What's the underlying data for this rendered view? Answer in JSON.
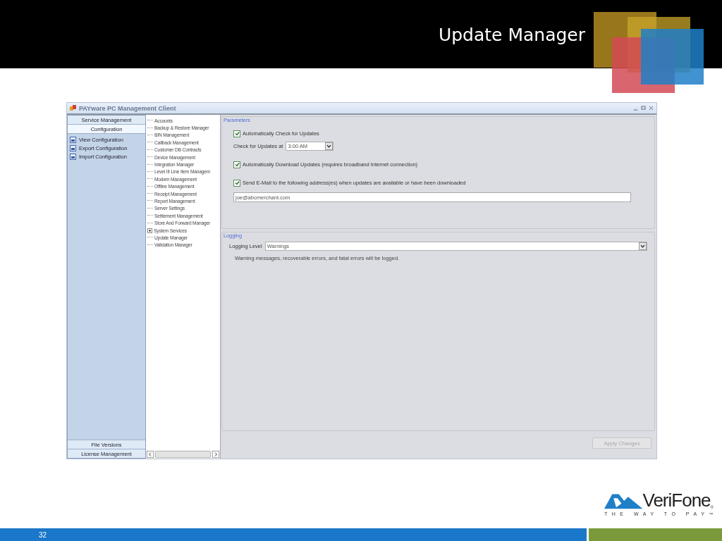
{
  "slide": {
    "title": "Update Manager",
    "page_number": "32"
  },
  "window": {
    "title": "PAYware PC Management Client"
  },
  "nav": {
    "top_buttons": [
      {
        "label": "Service Management",
        "selected": false
      },
      {
        "label": "Configuration",
        "selected": true
      }
    ],
    "items": [
      {
        "label": "View Configuration"
      },
      {
        "label": "Export Configuration"
      },
      {
        "label": "Import Configuration"
      }
    ],
    "bottom_buttons": [
      {
        "label": "File Versions"
      },
      {
        "label": "License Management"
      }
    ]
  },
  "tree": {
    "items": [
      {
        "label": "Accounts",
        "kind": "leaf"
      },
      {
        "label": "Backup & Restore Manager",
        "kind": "leaf"
      },
      {
        "label": "BIN Management",
        "kind": "leaf"
      },
      {
        "label": "Callback Management",
        "kind": "leaf"
      },
      {
        "label": "Customer DB Contracts",
        "kind": "leaf"
      },
      {
        "label": "Device Management",
        "kind": "leaf"
      },
      {
        "label": "Integration Manager",
        "kind": "leaf"
      },
      {
        "label": "Level III Line Item Managem",
        "kind": "leaf"
      },
      {
        "label": "Modem Management",
        "kind": "leaf"
      },
      {
        "label": "Offline Management",
        "kind": "leaf"
      },
      {
        "label": "Receipt Management",
        "kind": "leaf"
      },
      {
        "label": "Report Management",
        "kind": "leaf"
      },
      {
        "label": "Server Settings",
        "kind": "leaf"
      },
      {
        "label": "Settlement Management",
        "kind": "leaf"
      },
      {
        "label": "Store And Forward Manager",
        "kind": "leaf"
      },
      {
        "label": "System Services",
        "kind": "folder",
        "expanded": false
      },
      {
        "label": "Update Manager",
        "kind": "leaf"
      },
      {
        "label": "Validation Manager",
        "kind": "leaf"
      }
    ]
  },
  "parameters": {
    "title": "Parameters",
    "auto_check": {
      "label": "Automatically Check for Updates",
      "checked": true
    },
    "check_time": {
      "label": "Check for Updates at",
      "value": "3:00 AM"
    },
    "auto_download": {
      "label": "Automatically Download Updates (requires broadband Internet connection)",
      "checked": true
    },
    "send_email": {
      "label": "Send E-Mail to the following address(es) when updates are available or have been downloaded",
      "checked": true
    },
    "email": {
      "value": "joe@abcmerchant.com"
    }
  },
  "logging": {
    "title": "Logging",
    "level_label": "Logging Level",
    "level_value": "Warnings",
    "description": "Warning messages, recoverable errors, and fatal errors will be logged."
  },
  "apply_button": {
    "label": "Apply Changes",
    "disabled": true
  },
  "logo": {
    "name": "VeriFone",
    "mark": "®",
    "tagline": "THE WAY TO PAY",
    "trademark": "™"
  }
}
